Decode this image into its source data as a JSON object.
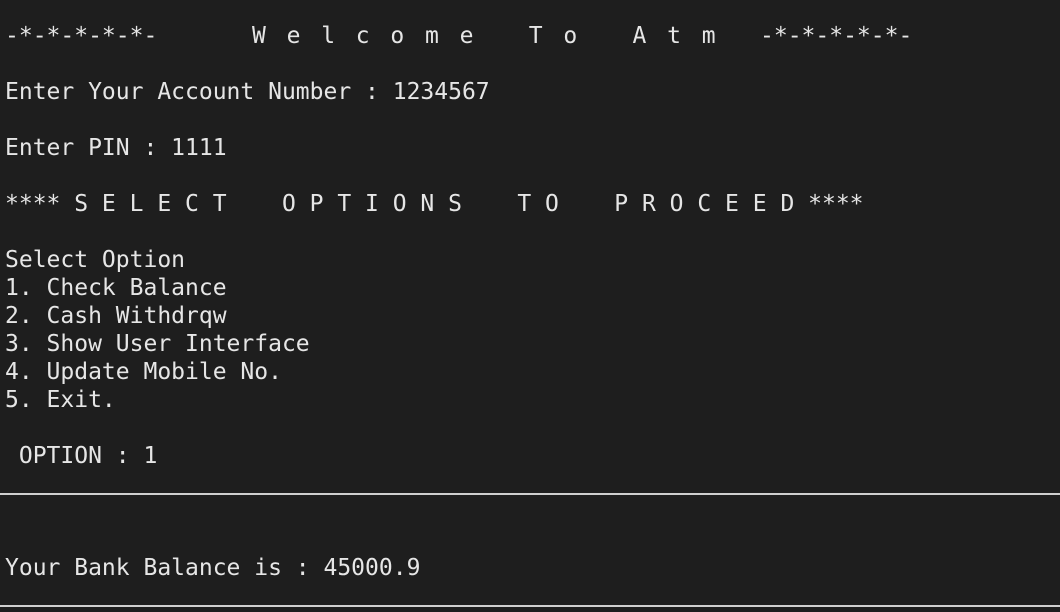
{
  "header": {
    "left_deco": "-*-*-*-*-*-",
    "title": "W e l c o m e   T o   A t m",
    "right_deco": "-*-*-*-*-*-"
  },
  "account_line": "Enter Your Account Number : 1234567",
  "pin_line": "Enter PIN : 1111",
  "options_banner": "**** S E L E C T    O P T I O N S    T O    P R O C E E D ****",
  "menu": {
    "heading": "Select Option",
    "items": [
      "1. Check Balance",
      "2. Cash Withdrqw",
      "3. Show User Interface",
      "4. Update Mobile No.",
      "5. Exit."
    ]
  },
  "option_line": " OPTION : 1",
  "balance_line": "Your Bank Balance is : 45000.9"
}
